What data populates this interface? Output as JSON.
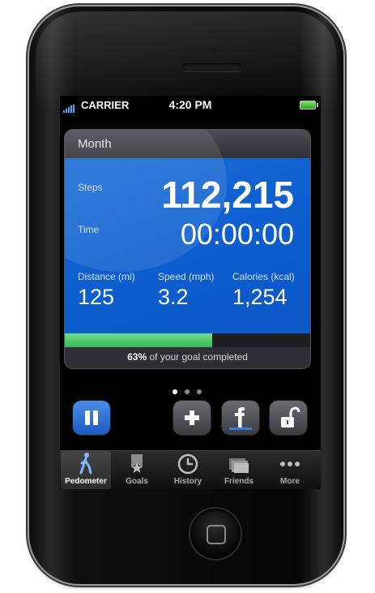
{
  "status": {
    "carrier": "CARRIER",
    "time": "4:20 PM"
  },
  "card": {
    "period": "Month",
    "steps_label": "Steps",
    "steps_value": "112,215",
    "time_label": "Time",
    "time_value": "00:00:00",
    "distance_label": "Distance (mi)",
    "distance_value": "125",
    "speed_label": "Speed (mph)",
    "speed_value": "3.2",
    "calories_label": "Calories (kcal)",
    "calories_value": "1,254",
    "goal_percent": "63%",
    "goal_text": " of your goal completed",
    "progress_fraction": 0.6
  },
  "pager": {
    "count": 3,
    "active": 0
  },
  "actions": [
    "pause-icon",
    "plus-icon",
    "facebook-icon",
    "unlock-icon"
  ],
  "tabs": [
    {
      "label": "Pedometer",
      "icon": "walker-icon",
      "active": true
    },
    {
      "label": "Goals",
      "icon": "ribbon-icon",
      "active": false
    },
    {
      "label": "History",
      "icon": "clock-icon",
      "active": false
    },
    {
      "label": "Friends",
      "icon": "friends-icon",
      "active": false
    },
    {
      "label": "More",
      "icon": "more-icon",
      "active": false
    }
  ],
  "colors": {
    "accent_blue": "#0e5fd0",
    "progress_green": "#44c266"
  }
}
